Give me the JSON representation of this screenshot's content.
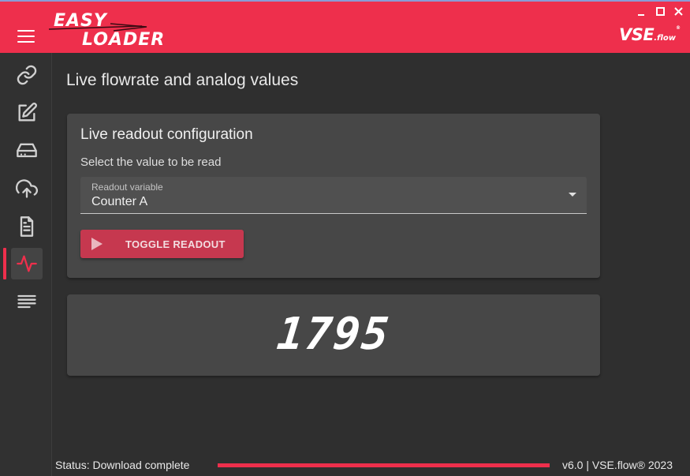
{
  "app": {
    "logo_line1": "EASY",
    "logo_line2": "LOADER",
    "brand_main": "VSE",
    "brand_sub": ".flow",
    "brand_reg": "®",
    "accent_color": "#ee2f4c"
  },
  "window_controls": [
    "minimize-icon",
    "maximize-icon",
    "close-icon"
  ],
  "sidebar": {
    "items": [
      {
        "name": "link-icon"
      },
      {
        "name": "edit-icon"
      },
      {
        "name": "drive-icon"
      },
      {
        "name": "upload-icon"
      },
      {
        "name": "document-icon"
      },
      {
        "name": "activity-icon",
        "active": true
      },
      {
        "name": "text-lines-icon"
      }
    ]
  },
  "main": {
    "page_title": "Live flowrate and analog values",
    "config_card": {
      "title": "Live readout configuration",
      "subtitle": "Select the value to be read",
      "select_label": "Readout variable",
      "select_value": "Counter A",
      "button_label": "TOGGLE READOUT"
    },
    "readout_value": "1795"
  },
  "status_bar": {
    "status_text": "Status: Download complete",
    "progress_fraction": 1.0,
    "version_text": "v6.0 | VSE.flow® 2023"
  }
}
